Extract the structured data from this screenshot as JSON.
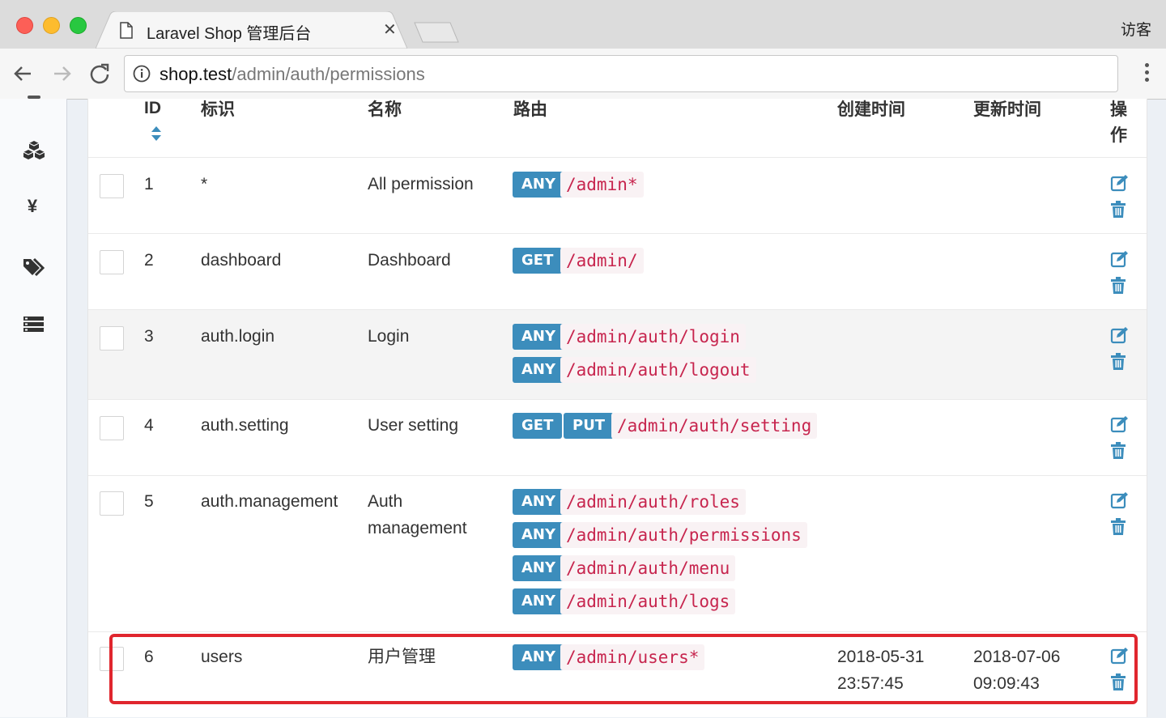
{
  "browser": {
    "tab_title": "Laravel Shop 管理后台",
    "user_label": "访客",
    "url_host": "shop.test",
    "url_path": "/admin/auth/permissions"
  },
  "sidebar": {
    "icons": [
      "cubes-icon",
      "yen-icon",
      "tags-icon",
      "list-icon"
    ],
    "yen_glyph": "¥"
  },
  "table": {
    "headers": {
      "id": "ID",
      "slug": "标识",
      "name": "名称",
      "route": "路由",
      "created": "创建时间",
      "updated": "更新时间",
      "action_1": "操",
      "action_2": "作"
    },
    "rows": [
      {
        "id": "1",
        "slug": "*",
        "name": "All permission",
        "name_2": "",
        "routes": [
          {
            "methods": [
              "ANY"
            ],
            "path": "/admin*"
          }
        ],
        "created_1": "",
        "created_2": "",
        "updated_1": "",
        "updated_2": ""
      },
      {
        "id": "2",
        "slug": "dashboard",
        "name": "Dashboard",
        "name_2": "",
        "routes": [
          {
            "methods": [
              "GET"
            ],
            "path": "/admin/"
          }
        ],
        "created_1": "",
        "created_2": "",
        "updated_1": "",
        "updated_2": ""
      },
      {
        "id": "3",
        "slug": "auth.login",
        "name": "Login",
        "name_2": "",
        "routes": [
          {
            "methods": [
              "ANY"
            ],
            "path": "/admin/auth/login"
          },
          {
            "methods": [
              "ANY"
            ],
            "path": "/admin/auth/logout"
          }
        ],
        "created_1": "",
        "created_2": "",
        "updated_1": "",
        "updated_2": ""
      },
      {
        "id": "4",
        "slug": "auth.setting",
        "name": "User setting",
        "name_2": "",
        "routes": [
          {
            "methods": [
              "GET",
              "PUT"
            ],
            "path": "/admin/auth/setting"
          }
        ],
        "created_1": "",
        "created_2": "",
        "updated_1": "",
        "updated_2": ""
      },
      {
        "id": "5",
        "slug": "auth.management",
        "name": "Auth",
        "name_2": "management",
        "routes": [
          {
            "methods": [
              "ANY"
            ],
            "path": "/admin/auth/roles"
          },
          {
            "methods": [
              "ANY"
            ],
            "path": "/admin/auth/permissions"
          },
          {
            "methods": [
              "ANY"
            ],
            "path": "/admin/auth/menu"
          },
          {
            "methods": [
              "ANY"
            ],
            "path": "/admin/auth/logs"
          }
        ],
        "created_1": "",
        "created_2": "",
        "updated_1": "",
        "updated_2": ""
      },
      {
        "id": "6",
        "slug": "users",
        "name": "用户管理",
        "name_2": "",
        "routes": [
          {
            "methods": [
              "ANY"
            ],
            "path": "/admin/users*"
          }
        ],
        "created_1": "2018-05-31",
        "created_2": "23:57:45",
        "updated_1": "2018-07-06",
        "updated_2": "09:09:43"
      }
    ]
  },
  "colors": {
    "badge": "#3c8dbc",
    "code_text": "#c7254e",
    "code_bg": "#f9f2f4",
    "highlight": "#e0262e",
    "action_icon": "#3c8dbc"
  }
}
